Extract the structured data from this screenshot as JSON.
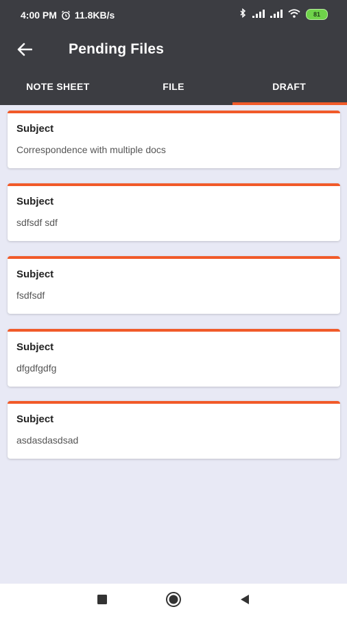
{
  "status_bar": {
    "time": "4:00 PM",
    "speed": "11.8KB/s",
    "battery": "81",
    "icons": [
      "alarm-icon",
      "bluetooth-icon",
      "signal-icon",
      "signal-icon",
      "wifi-icon",
      "battery-icon"
    ]
  },
  "app_bar": {
    "title": "Pending Files",
    "back_icon": "arrow-left-icon"
  },
  "tabs": [
    {
      "label": "NOTE SHEET",
      "active": false
    },
    {
      "label": "FILE",
      "active": false
    },
    {
      "label": "DRAFT",
      "active": true
    }
  ],
  "items": [
    {
      "label": "Subject",
      "value": "Correspondence with multiple docs"
    },
    {
      "label": "Subject",
      "value": "sdfsdf sdf"
    },
    {
      "label": "Subject",
      "value": "fsdfsdf"
    },
    {
      "label": "Subject",
      "value": "dfgdfgdfg"
    },
    {
      "label": "Subject",
      "value": "asdasdasdsad"
    }
  ],
  "nav_bar": {
    "icons": [
      "recents-square-icon",
      "home-circle-icon",
      "back-triangle-icon"
    ]
  },
  "colors": {
    "header": "#3c3d42",
    "accent": "#f15a29",
    "background": "#e8e9f5"
  }
}
